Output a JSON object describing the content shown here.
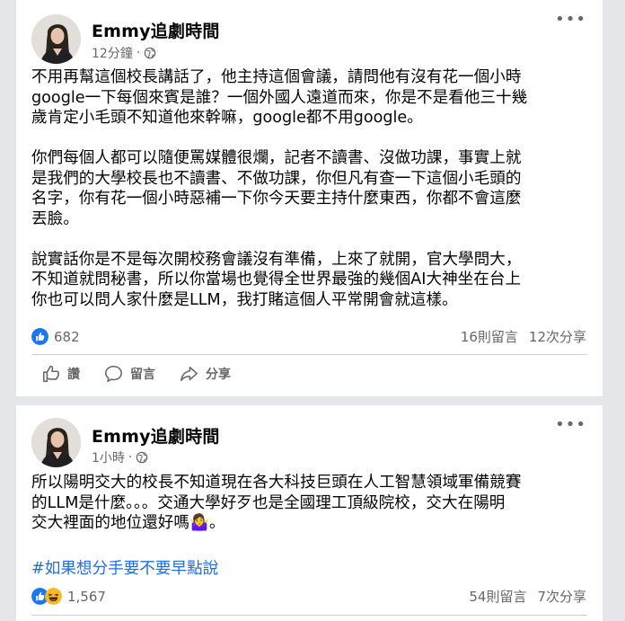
{
  "posts": [
    {
      "author": "Emmy追劇時間",
      "time": "12分鐘",
      "dot": "·",
      "more": "•••",
      "paragraphs": [
        "不用再幫這個校長講話了，他主持這個會議，請問他有沒有花一個小時\ngoogle一下每個來賓是誰？一個外國人遠道而來，你是不是看他三十幾\n歲肯定小毛頭不知道他來幹嘛，google都不用google。",
        "你們每個人都可以隨便罵媒體很爛，記者不讀書、沒做功課，事實上就\n是我們的大學校長也不讀書、不做功課，你但凡有查一下這個小毛頭的\n名字，你有花一個小時惡補一下你今天要主持什麼東西，你都不會這麼\n丟臉。",
        "說實話你是不是每次開校務會議沒有準備，上來了就開，官大學問大，\n不知道就問秘書，所以你當場也覺得全世界最強的幾個AI大神坐在台上\n你也可以問人家什麼是LLM，我打賭這個人平常開會就這樣。"
      ],
      "reaction_count": "682",
      "comments": "16則留言",
      "shares": "12次分享",
      "actions": {
        "like": "讚",
        "comment": "留言",
        "share": "分享"
      }
    },
    {
      "author": "Emmy追劇時間",
      "time": "1小時",
      "dot": "·",
      "more": "•••",
      "paragraphs": [
        "所以陽明交大的校長不知道現在各大科技巨頭在人工智慧領域軍備競賽\n的LLM是什麼。。。交通大學好歹也是全國理工頂級院校，交大在陽明\n交大裡面的地位還好嗎🤷‍♀️。"
      ],
      "hashtag": "#如果想分手要不要早點說",
      "reaction_count": "1,567",
      "comments": "54則留言",
      "shares": "7次分享"
    }
  ],
  "colors": {
    "like_blue": "#1877f2",
    "haha_yellow": "#f7b928",
    "hashtag_blue": "#216fdb",
    "meta_gray": "#65676b"
  }
}
